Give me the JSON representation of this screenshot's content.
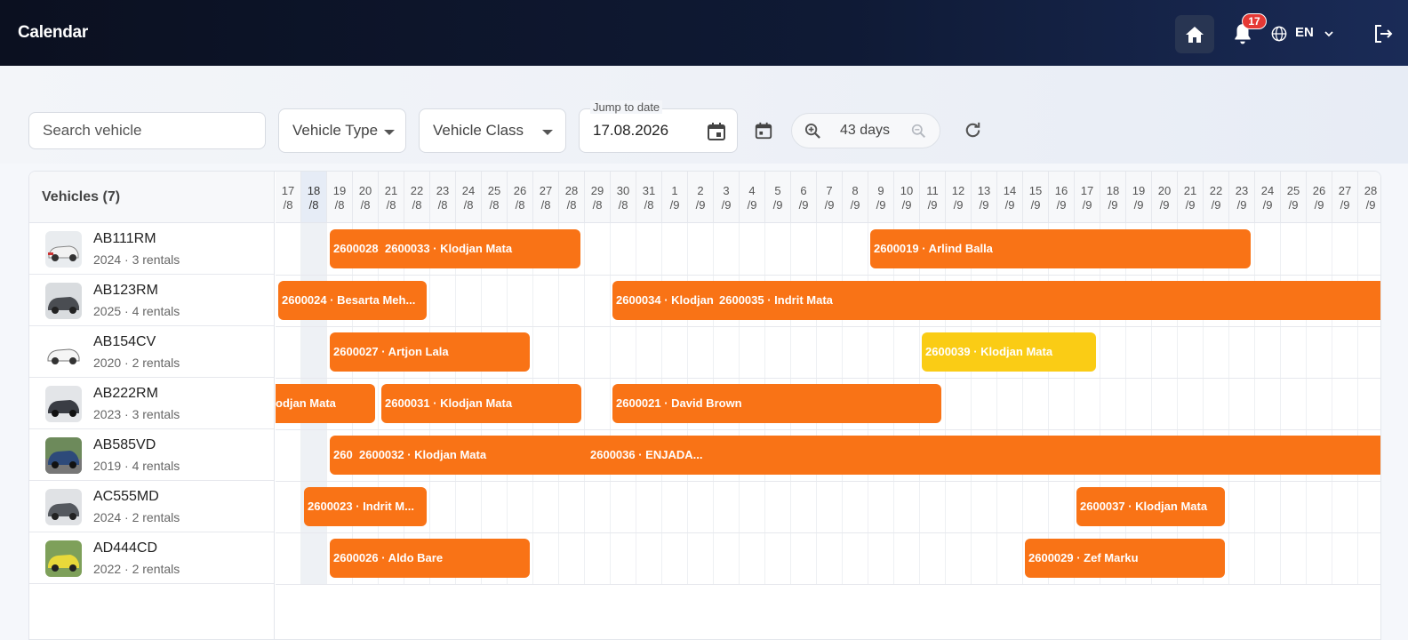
{
  "header": {
    "title": "Calendar",
    "notifications_count": "17",
    "language": "EN"
  },
  "toolbar": {
    "search_placeholder": "Search vehicle",
    "vehicle_type_label": "Vehicle Type",
    "vehicle_class_label": "Vehicle Class",
    "jump_label": "Jump to date",
    "jump_value": "17.08.2026",
    "zoom_value": "43 days"
  },
  "vehicles_header": "Vehicles (7)",
  "vehicles": [
    {
      "plate": "AB111RM",
      "meta": "2024 · 3 rentals"
    },
    {
      "plate": "AB123RM",
      "meta": "2025 · 4 rentals"
    },
    {
      "plate": "AB154CV",
      "meta": "2020 · 2 rentals"
    },
    {
      "plate": "AB222RM",
      "meta": "2023 · 3 rentals"
    },
    {
      "plate": "AB585VD",
      "meta": "2019 · 4 rentals"
    },
    {
      "plate": "AC555MD",
      "meta": "2024 · 2 rentals"
    },
    {
      "plate": "AD444CD",
      "meta": "2022 · 2 rentals"
    }
  ],
  "days": [
    {
      "d": "17",
      "m": "/8"
    },
    {
      "d": "18",
      "m": "/8"
    },
    {
      "d": "19",
      "m": "/8"
    },
    {
      "d": "20",
      "m": "/8"
    },
    {
      "d": "21",
      "m": "/8"
    },
    {
      "d": "22",
      "m": "/8"
    },
    {
      "d": "23",
      "m": "/8"
    },
    {
      "d": "24",
      "m": "/8"
    },
    {
      "d": "25",
      "m": "/8"
    },
    {
      "d": "26",
      "m": "/8"
    },
    {
      "d": "27",
      "m": "/8"
    },
    {
      "d": "28",
      "m": "/8"
    },
    {
      "d": "29",
      "m": "/8"
    },
    {
      "d": "30",
      "m": "/8"
    },
    {
      "d": "31",
      "m": "/8"
    },
    {
      "d": "1",
      "m": "/9"
    },
    {
      "d": "2",
      "m": "/9"
    },
    {
      "d": "3",
      "m": "/9"
    },
    {
      "d": "4",
      "m": "/9"
    },
    {
      "d": "5",
      "m": "/9"
    },
    {
      "d": "6",
      "m": "/9"
    },
    {
      "d": "7",
      "m": "/9"
    },
    {
      "d": "8",
      "m": "/9"
    },
    {
      "d": "9",
      "m": "/9"
    },
    {
      "d": "10",
      "m": "/9"
    },
    {
      "d": "11",
      "m": "/9"
    },
    {
      "d": "12",
      "m": "/9"
    },
    {
      "d": "13",
      "m": "/9"
    },
    {
      "d": "14",
      "m": "/9"
    },
    {
      "d": "15",
      "m": "/9"
    },
    {
      "d": "16",
      "m": "/9"
    },
    {
      "d": "17",
      "m": "/9"
    },
    {
      "d": "18",
      "m": "/9"
    },
    {
      "d": "19",
      "m": "/9"
    },
    {
      "d": "20",
      "m": "/9"
    },
    {
      "d": "21",
      "m": "/9"
    },
    {
      "d": "22",
      "m": "/9"
    },
    {
      "d": "23",
      "m": "/9"
    },
    {
      "d": "24",
      "m": "/9"
    },
    {
      "d": "25",
      "m": "/9"
    },
    {
      "d": "26",
      "m": "/9"
    },
    {
      "d": "27",
      "m": "/9"
    },
    {
      "d": "28",
      "m": "/9"
    }
  ],
  "bookings": {
    "r0a1": "2600028",
    "r0a2": "2600033 · Klodjan Mata",
    "r0b": "2600019 · Arlind Balla",
    "r1a": "2600024 · Besarta Meh...",
    "r1b1": "2600034 · Klodjan",
    "r1b2": "2600035 · Indrit Mata",
    "r2a": "2600027 · Artjon Lala",
    "r2b": "2600039 · Klodjan Mata",
    "r3a": "odjan Mata",
    "r3b": "2600031 · Klodjan Mata",
    "r3c": "2600021 · David Brown",
    "r4a1": "260",
    "r4a2": "2600032 · Klodjan Mata",
    "r4a3": "2600036 · ENJADA...",
    "r5a": "2600023 · Indrit M...",
    "r5b": "2600037 · Klodjan Mata",
    "r6a": "2600026 · Aldo Bare",
    "r6b": "2600029 · Zef Marku"
  },
  "colors": {
    "booking": "#f97316",
    "booking_pending": "#facc15",
    "header_bg": "#0f1a35"
  }
}
